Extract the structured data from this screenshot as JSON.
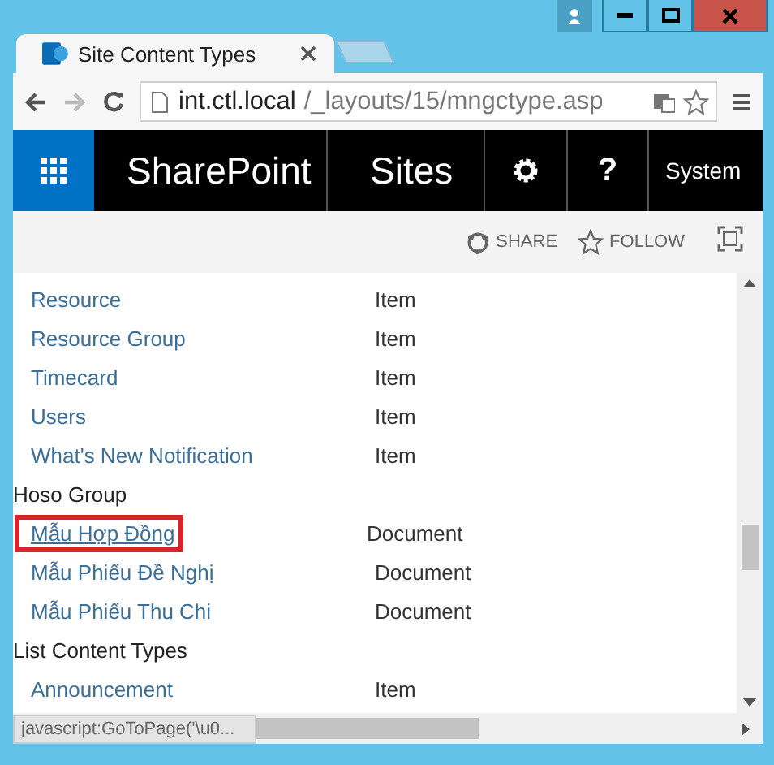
{
  "tab": {
    "title": "Site Content Types"
  },
  "address": {
    "host": "int.ctl.local",
    "path": "/_layouts/15/mngctype.asp"
  },
  "suite_bar": {
    "brand": "SharePoint",
    "site": "Sites",
    "help": "?",
    "user": "System"
  },
  "actions": [
    {
      "label": "SHARE",
      "kind": "share"
    },
    {
      "label": "FOLLOW",
      "kind": "follow"
    }
  ],
  "list": [
    {
      "kind": "row",
      "name": "Resource",
      "type": "Item",
      "selected": false
    },
    {
      "kind": "row",
      "name": "Resource Group",
      "type": "Item",
      "selected": false
    },
    {
      "kind": "row",
      "name": "Timecard",
      "type": "Item",
      "selected": false
    },
    {
      "kind": "row",
      "name": "Users",
      "type": "Item",
      "selected": false
    },
    {
      "kind": "row",
      "name": "What's New Notification",
      "type": "Item",
      "selected": false
    },
    {
      "kind": "group",
      "name": "Hoso Group"
    },
    {
      "kind": "row",
      "name": "Mẫu Hợp Đồng",
      "type": "Document",
      "selected": true
    },
    {
      "kind": "row",
      "name": "Mẫu Phiếu Đề Nghị",
      "type": "Document",
      "selected": false
    },
    {
      "kind": "row",
      "name": "Mẫu Phiếu Thu Chi",
      "type": "Document",
      "selected": false
    },
    {
      "kind": "group",
      "name": "List Content Types"
    },
    {
      "kind": "row",
      "name": "Announcement",
      "type": "Item",
      "selected": false
    }
  ],
  "status_bar": {
    "text": "javascript:GoToPage('\\u0..."
  }
}
